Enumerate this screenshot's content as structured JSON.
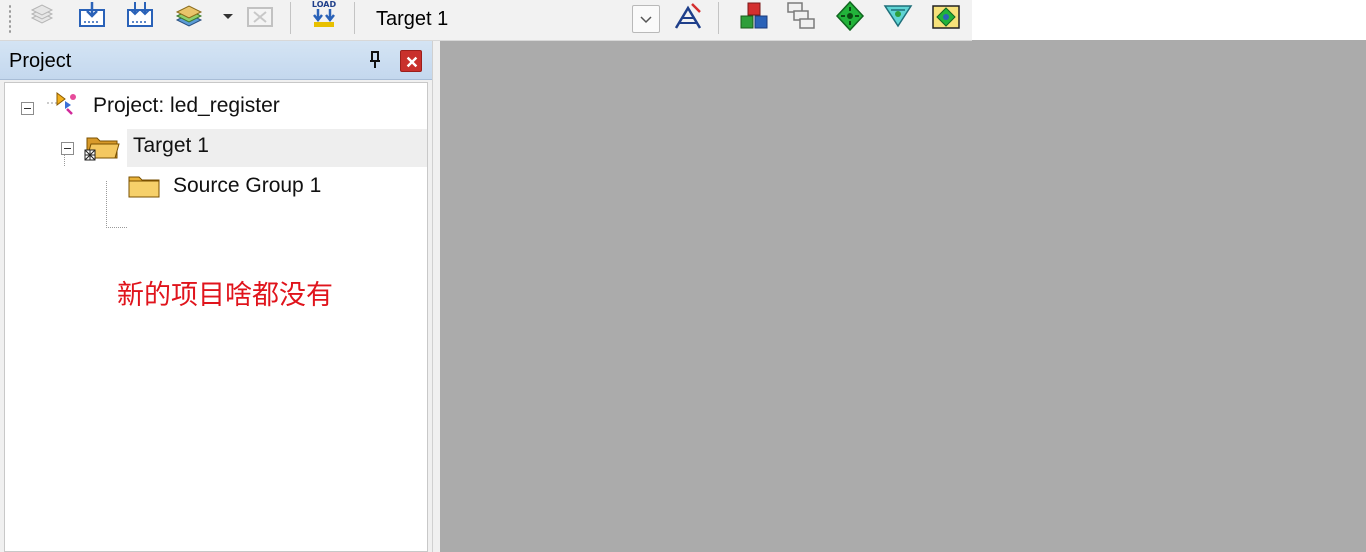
{
  "toolbar": {
    "target_select": {
      "value": "Target 1"
    },
    "icons": [
      "translate-icon",
      "build-icon",
      "rebuild-icon",
      "batch-build-icon",
      "dropdown-arrow-icon",
      "stop-build-icon",
      "download-load-icon",
      "target-options-icon",
      "manage-components-icon",
      "select-packs-icon",
      "pack-installer-icon",
      "rte-icon",
      "event-recorder-icon"
    ]
  },
  "project_panel": {
    "title": "Project",
    "tree": {
      "root": "Project: led_register",
      "target": "Target 1",
      "group": "Source Group 1"
    },
    "annotation": "新的项目啥都没有"
  },
  "colors": {
    "annotation": "#e0141c",
    "close": "#c9302c",
    "workspace": "#ababab"
  }
}
